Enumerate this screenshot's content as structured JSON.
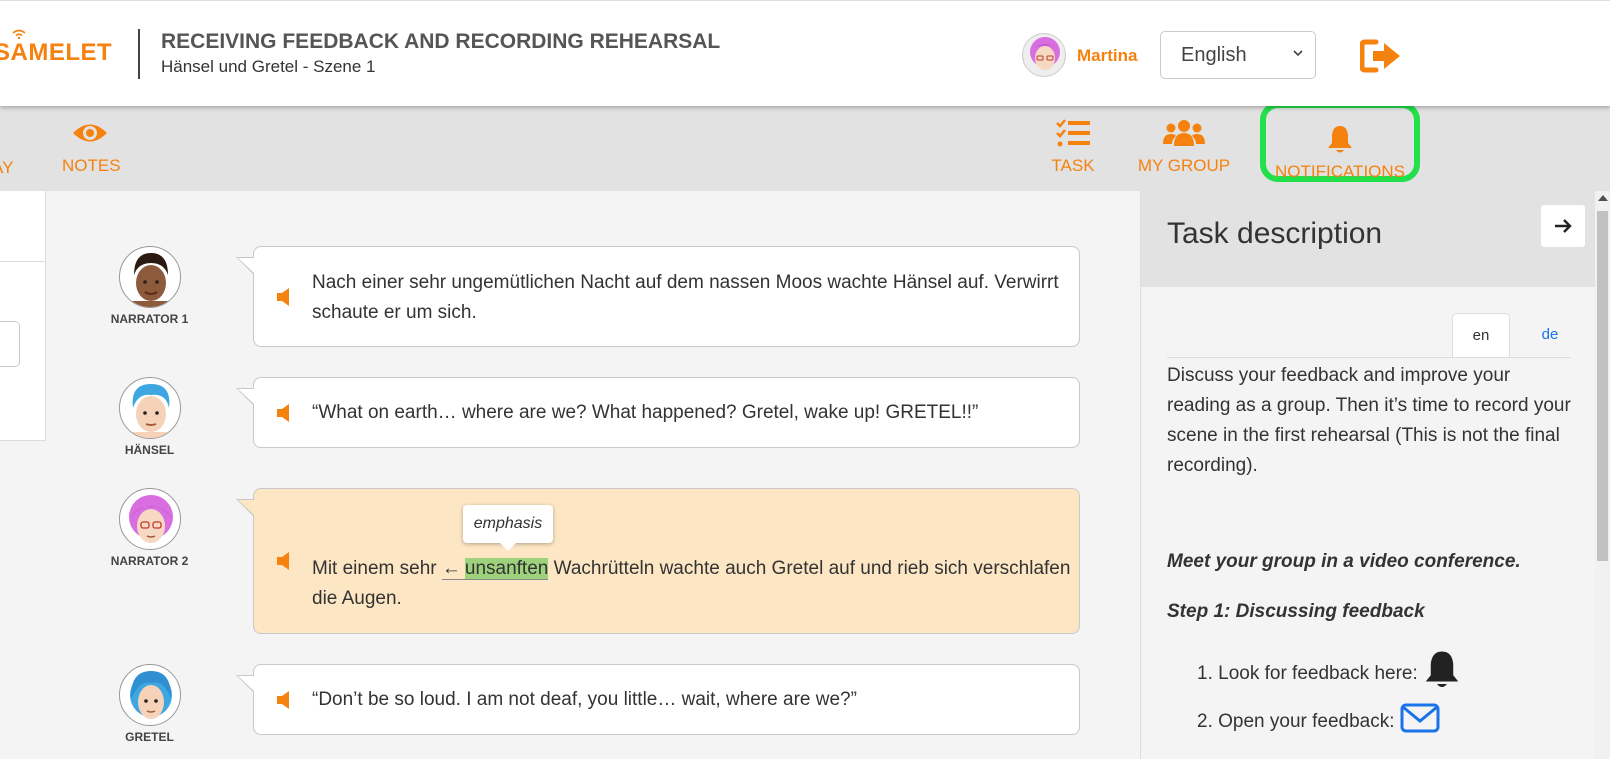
{
  "header": {
    "logo_text": "SAMELET",
    "title": "RECEIVING FEEDBACK AND RECORDING REHEARSAL",
    "subtitle": "Hänsel und Gretel - Szene 1",
    "user_name": "Martina",
    "language": "English"
  },
  "toolbar": {
    "play_partial": "AY",
    "notes": "NOTES",
    "task": "TASK",
    "my_group": "MY GROUP",
    "notifications": "NOTIFICATIONS"
  },
  "script": {
    "lines": [
      {
        "character": "NARRATOR 1",
        "text": "Nach einer sehr ungemütlichen Nacht auf dem nassen Moos wachte Hänsel auf. Verwirrt schaute er um sich."
      },
      {
        "character": "HÄNSEL",
        "text": "“What on earth… where are we? What happened? Gretel, wake up! GRETEL!!”"
      },
      {
        "character": "NARRATOR 2",
        "text_before": "Mit einem sehr",
        "arrow": "←",
        "highlight": "unsanften",
        "text_after": "Wachrütteln wachte auch Gretel auf und rieb sich verschlafen die Augen.",
        "tooltip": "emphasis"
      },
      {
        "character": "GRETEL",
        "text": "“Don’t be so loud. I am not deaf, you little… wait, where are we?”"
      }
    ]
  },
  "task_panel": {
    "title": "Task description",
    "tab_en": "en",
    "tab_de": "de",
    "body": "Discuss your feedback and improve your reading as a group. Then it’s time to record your scene in the first rehearsal (This is not the final recording).",
    "meet": "Meet your group in a video conference.",
    "step1": "Step 1: Discussing feedback",
    "item1": "1. Look for feedback here:",
    "item2": "2. Open your feedback:"
  },
  "colors": {
    "accent": "#f5820f",
    "highlight_frame": "#22e04a",
    "highlight_word": "#9ed17c",
    "active_line_bg": "#fde6c4",
    "link": "#1a73e8"
  }
}
